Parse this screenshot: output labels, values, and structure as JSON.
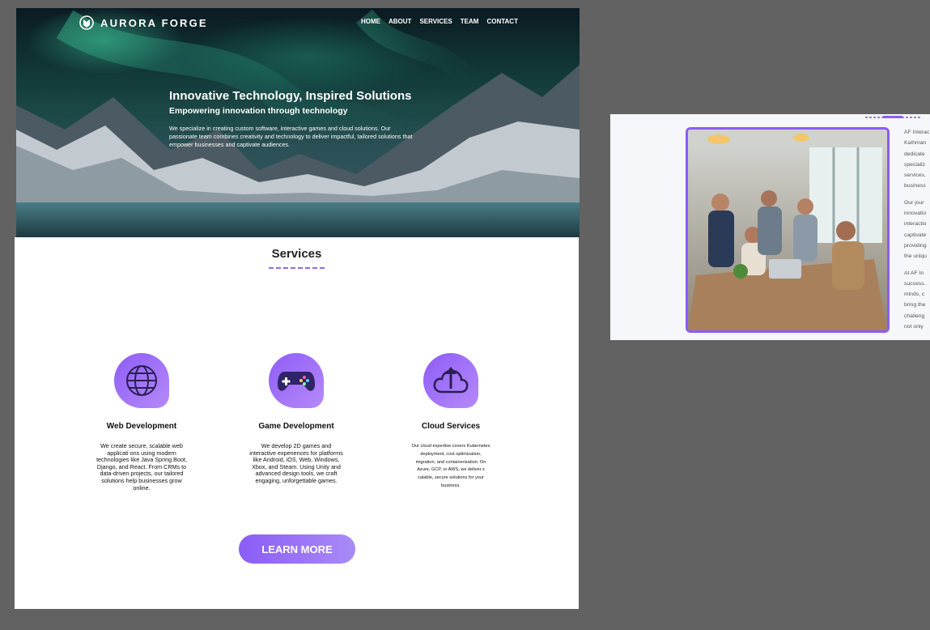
{
  "nav": {
    "brand": "AURORA FORGE",
    "links": [
      "HOME",
      "ABOUT",
      "SERVICES",
      "TEAM",
      "CONTACT"
    ]
  },
  "hero": {
    "title": "Innovative Technology, Inspired Solutions",
    "subtitle": "Empowering innovation through technology",
    "description": "We specialize in creating custom software, interactive games and cloud solutions. Our passionate team combines creativity and technology to deliver impactful, tailored solutions that empower businesses and captivate  audiences."
  },
  "services": {
    "title": "Services",
    "cards": [
      {
        "title": "Web Development",
        "icon": "globe-icon",
        "description": "We create secure, scalable web applicati ons using modern technologies like Java Spring Boot, Django, and React. From CRMs to data-driven projects, our tailored solutions help businesses grow online."
      },
      {
        "title": "Game Development",
        "icon": "gamepad-icon",
        "description": "We develop 2D games and interactive experiences for platforms like Android, iOS, Web, Windows, Xbox, and Steam. Using Unity and advanced design tools, we craft engaging, unforgettable games."
      },
      {
        "title": "Cloud Services",
        "icon": "cloud-upload-icon",
        "description": "Our cloud expertise covers Kubernetes deployment, cost optimization, migration, and containerization. On Azure, GCP, or AWS, we deliver s calable, secure solutions for your business."
      }
    ],
    "cta": "LEARN MORE"
  },
  "about": {
    "lines": [
      [
        "AF Interac",
        "Kathman",
        "dedicate",
        "specializ",
        "services,",
        "business"
      ],
      [
        "Our  jour",
        "innovatio",
        "interactio",
        "captivate",
        "providing",
        "the uniqu"
      ],
      [
        "At  AF  In",
        "success.",
        "minds,  c",
        "bring the",
        "challeng",
        "not only"
      ]
    ]
  },
  "colors": {
    "accent": "#8b5cf6",
    "accent_light": "#b58af8",
    "canvas_bg": "#626262"
  }
}
